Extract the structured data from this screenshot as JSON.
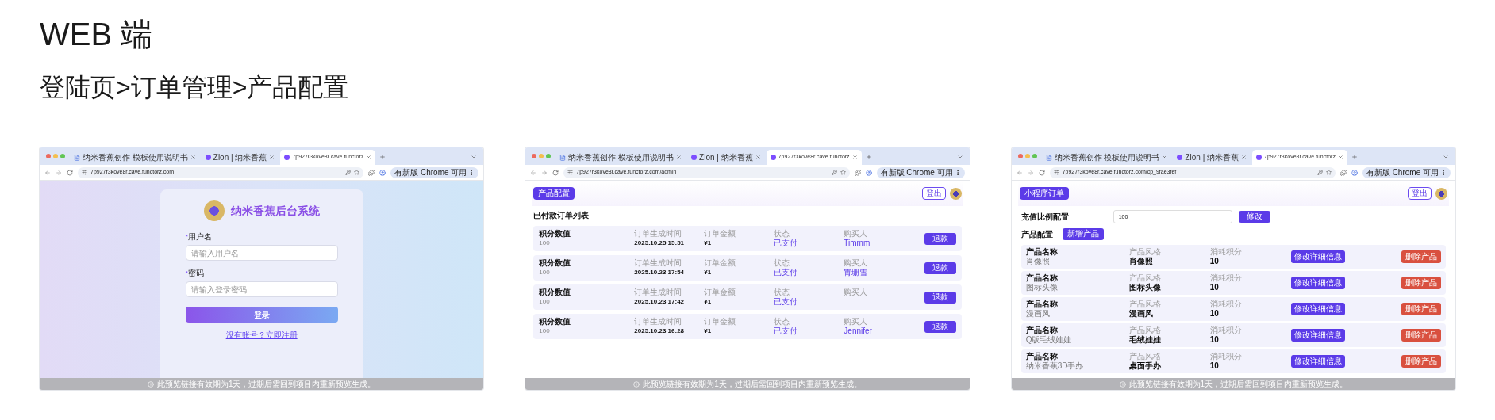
{
  "title": "WEB 端",
  "subtitle": "登陆页>订单管理>产品配置",
  "screens": [
    {
      "kind": "login",
      "browser": {
        "tabs": [
          {
            "label": "纳米香蕉创作 模板使用说明书",
            "selected": false
          },
          {
            "label": "Zion | 纳米香蕉",
            "selected": false
          },
          {
            "label": "7p927r3kove8r.cave.functorz",
            "selected": true
          }
        ],
        "url": "7p927r3kove8r.cave.functorz.com",
        "update_button": "有新版 Chrome 可用"
      },
      "app_name": "纳米香蕉后台系统",
      "fields": [
        {
          "mark": "*",
          "label": "用户名",
          "placeholder": "请输入用户名"
        },
        {
          "mark": "*",
          "label": "密码",
          "placeholder": "请输入登录密码"
        }
      ],
      "login_button": "登录",
      "register_link": "没有账号？立即注册",
      "footer": "此预览链接有效期为1天，过期后需回到项目内重新预览生成。"
    },
    {
      "kind": "orders",
      "browser": {
        "tabs": [
          {
            "label": "纳米香蕉创作 模板使用说明书",
            "selected": false
          },
          {
            "label": "Zion | 纳米香蕉",
            "selected": false
          },
          {
            "label": "7p927r3kove8r.cave.functorz",
            "selected": true
          }
        ],
        "url": "7p927r3kove8r.cave.functorz.com/admin",
        "update_button": "有新版 Chrome 可用"
      },
      "nav_button": "产品配置",
      "logout_button": "登出",
      "heading": "已付款订单列表",
      "rows": [
        {
          "cells": [
            {
              "label": "积分数值",
              "value": "100"
            },
            {
              "label": "订单生成时间",
              "value": "2025.10.25 15:51"
            },
            {
              "label": "订单金额",
              "value": "¥1"
            },
            {
              "label": "状态",
              "value": "已支付"
            },
            {
              "label": "购买人",
              "value": "Timmm"
            }
          ],
          "action": "退款"
        },
        {
          "cells": [
            {
              "label": "积分数值",
              "value": "100"
            },
            {
              "label": "订单生成时间",
              "value": "2025.10.23 17:54"
            },
            {
              "label": "订单金额",
              "value": "¥1"
            },
            {
              "label": "状态",
              "value": "已支付"
            },
            {
              "label": "购买人",
              "value": "霄珊雪"
            }
          ],
          "action": "退款"
        },
        {
          "cells": [
            {
              "label": "积分数值",
              "value": "100"
            },
            {
              "label": "订单生成时间",
              "value": "2025.10.23 17:42"
            },
            {
              "label": "订单金额",
              "value": "¥1"
            },
            {
              "label": "状态",
              "value": "已支付"
            },
            {
              "label": "购买人"
            }
          ],
          "action": "退款"
        },
        {
          "cells": [
            {
              "label": "积分数值",
              "value": "100"
            },
            {
              "label": "订单生成时间",
              "value": "2025.10.23 16:28"
            },
            {
              "label": "订单金额",
              "value": "¥1"
            },
            {
              "label": "状态",
              "value": "已支付"
            },
            {
              "label": "购买人",
              "value": "Jennifer"
            }
          ],
          "action": "退款"
        }
      ],
      "footer": "此预览链接有效期为1天，过期后需回到项目内重新预览生成。"
    },
    {
      "kind": "products",
      "browser": {
        "tabs": [
          {
            "label": "纳米香蕉创作 模板使用说明书",
            "selected": false
          },
          {
            "label": "Zion | 纳米香蕉",
            "selected": false
          },
          {
            "label": "7p927r3kove8r.cave.functorz",
            "selected": true
          }
        ],
        "url": "7p927r3kove8r.cave.functorz.com/cp_9fae3fef",
        "update_button": "有新版 Chrome 可用"
      },
      "nav_button": "小程序订单",
      "logout_button": "登出",
      "ratio_label": "充值比例配置",
      "ratio_value": "100",
      "ratio_button": "修改",
      "section": "产品配置",
      "add_button": "新增产品",
      "rows": [
        {
          "cells": [
            {
              "label": "产品名称",
              "value": "肖像照"
            },
            {
              "label": "产品风格",
              "value": "肖像照"
            },
            {
              "label": "消耗积分",
              "value": "10"
            }
          ],
          "edit": "修改详细信息",
          "delete": "删除产品"
        },
        {
          "cells": [
            {
              "label": "产品名称",
              "value": "图标头像"
            },
            {
              "label": "产品风格",
              "value": "图标头像"
            },
            {
              "label": "消耗积分",
              "value": "10"
            }
          ],
          "edit": "修改详细信息",
          "delete": "删除产品"
        },
        {
          "cells": [
            {
              "label": "产品名称",
              "value": "漫画风"
            },
            {
              "label": "产品风格",
              "value": "漫画风"
            },
            {
              "label": "消耗积分",
              "value": "10"
            }
          ],
          "edit": "修改详细信息",
          "delete": "删除产品"
        },
        {
          "cells": [
            {
              "label": "产品名称",
              "value": "Q版毛绒娃娃"
            },
            {
              "label": "产品风格",
              "value": "毛绒娃娃"
            },
            {
              "label": "消耗积分",
              "value": "10"
            }
          ],
          "edit": "修改详细信息",
          "delete": "删除产品"
        },
        {
          "cells": [
            {
              "label": "产品名称",
              "value": "纳米香蕉3D手办"
            },
            {
              "label": "产品风格",
              "value": "桌面手办"
            },
            {
              "label": "消耗积分",
              "value": "10"
            }
          ],
          "edit": "修改详细信息",
          "delete": "删除产品"
        }
      ],
      "footer": "此预览链接有效期为1天，过期后需回到项目内重新预览生成。"
    }
  ]
}
